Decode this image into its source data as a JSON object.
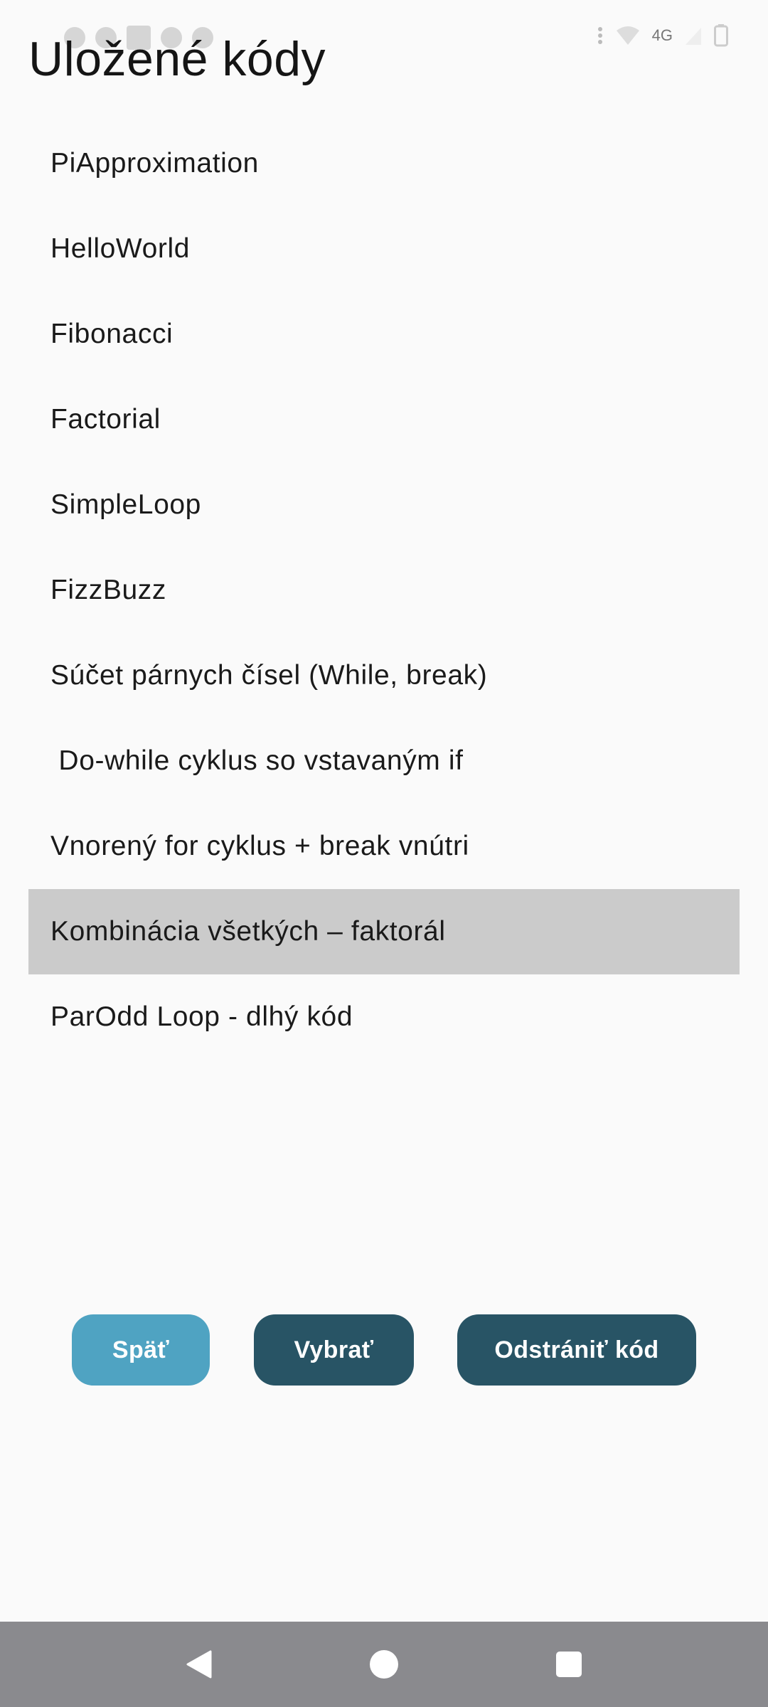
{
  "status_bar": {
    "network_label": "4G",
    "icons": [
      "notification-icon",
      "notification-icon",
      "notification-icon",
      "settings-icon",
      "signal-icon",
      "wifi-icon",
      "battery-icon"
    ]
  },
  "title": "Uložené kódy",
  "codes": [
    {
      "label": "PiApproximation",
      "selected": false
    },
    {
      "label": "HelloWorld",
      "selected": false
    },
    {
      "label": "Fibonacci",
      "selected": false
    },
    {
      "label": "Factorial",
      "selected": false
    },
    {
      "label": "SimpleLoop",
      "selected": false
    },
    {
      "label": "FizzBuzz",
      "selected": false
    },
    {
      "label": "Súčet párnych čísel (While, break)",
      "selected": false
    },
    {
      "label": " Do-while cyklus so vstavaným if",
      "selected": false
    },
    {
      "label": "Vnorený for cyklus + break vnútri",
      "selected": false
    },
    {
      "label": "Kombinácia všetkých – faktorál",
      "selected": true
    },
    {
      "label": "ParOdd Loop - dlhý kód",
      "selected": false
    }
  ],
  "buttons": {
    "back_label": "Späť",
    "select_label": "Vybrať",
    "delete_label": "Odstrániť kód"
  },
  "colors": {
    "back_button": "#4fa3c2",
    "primary_button": "#285465",
    "selected_row": "#cbcbcb",
    "nav_bar": "#8a8a8e"
  },
  "nav": {
    "icons": [
      "back-icon",
      "home-icon",
      "recents-icon"
    ]
  }
}
